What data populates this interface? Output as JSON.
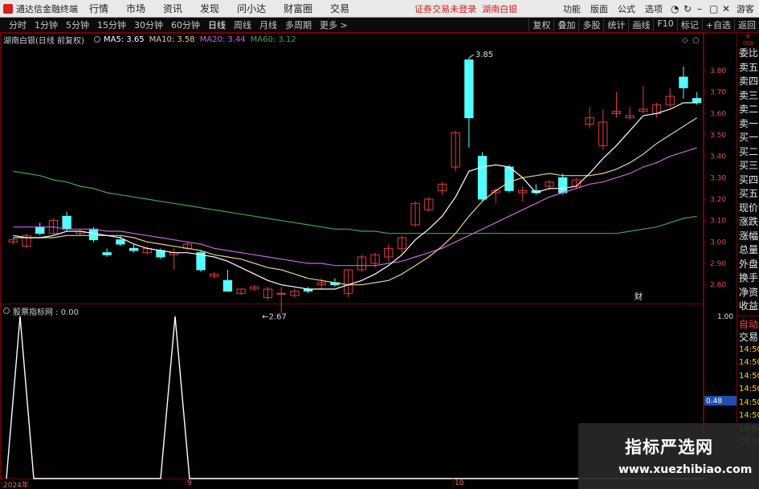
{
  "topbar": {
    "app_title": "通达信金融终端",
    "menu": [
      "行情",
      "市场",
      "资讯",
      "发现",
      "问小达",
      "财富圈",
      "交易"
    ],
    "status": "证券交易未登录",
    "stock": "湖南白银",
    "right": [
      "功能",
      "版面",
      "公式",
      "选项"
    ],
    "guest": "游客"
  },
  "periodbar": {
    "periods": [
      "分时",
      "1分钟",
      "5分钟",
      "15分钟",
      "30分钟",
      "60分钟",
      "日线",
      "周线",
      "月线",
      "多周期",
      "更多 >"
    ],
    "active": "日线",
    "tools": [
      "复权",
      "叠加",
      "多股",
      "统计",
      "画线",
      "F10",
      "标记",
      "+自选",
      "返回"
    ]
  },
  "info": {
    "title": "湖南白银(日线 前复权)",
    "ma5": "MA5: 3.65",
    "ma10": "MA10: 3.58",
    "ma20": "MA20: 3.44",
    "ma60": "MA60: 3.12"
  },
  "sub": {
    "label": "股票指标网 : 0.00"
  },
  "colors": {
    "up": "#e23b3b",
    "down": "#54ffff",
    "ma5": "#ffffff",
    "ma10": "#e6d08a",
    "ma20": "#d060e0",
    "ma60": "#3fa83f",
    "indicator": "#ffffff",
    "frame": "#7a0000"
  },
  "chart_data": [
    {
      "type": "candlestick",
      "series_name": "湖南白银",
      "price_axis": [
        "3.80",
        "3.70",
        "3.60",
        "3.50",
        "3.40",
        "3.30",
        "3.20",
        "3.10",
        "3.00",
        "2.90",
        "2.80"
      ],
      "ylim": [
        2.72,
        3.92
      ],
      "annotations": {
        "high": "3.85",
        "low": "2.67",
        "marker": "财"
      },
      "x_labels": [
        "2024年",
        "9",
        "10"
      ],
      "candles": [
        [
          3.0,
          3.02,
          2.99,
          3.01
        ],
        [
          2.98,
          3.04,
          2.97,
          3.03
        ],
        [
          3.07,
          3.09,
          3.03,
          3.04
        ],
        [
          3.04,
          3.11,
          3.03,
          3.1
        ],
        [
          3.12,
          3.14,
          3.05,
          3.06
        ],
        [
          3.04,
          3.06,
          3.03,
          3.05
        ],
        [
          3.06,
          3.07,
          3.0,
          3.01
        ],
        [
          2.95,
          2.97,
          2.93,
          2.94
        ],
        [
          3.01,
          3.03,
          2.98,
          2.99
        ],
        [
          2.97,
          2.99,
          2.95,
          2.96
        ],
        [
          2.95,
          2.98,
          2.94,
          2.97
        ],
        [
          2.96,
          2.97,
          2.92,
          2.93
        ],
        [
          2.94,
          2.97,
          2.87,
          2.95
        ],
        [
          2.97,
          3.0,
          2.96,
          2.99
        ],
        [
          2.95,
          2.96,
          2.86,
          2.87
        ],
        [
          2.84,
          2.86,
          2.83,
          2.85
        ],
        [
          2.82,
          2.87,
          2.81,
          2.77
        ],
        [
          2.76,
          2.78,
          2.75,
          2.78
        ],
        [
          2.78,
          2.8,
          2.77,
          2.79
        ],
        [
          2.74,
          2.79,
          2.73,
          2.78
        ],
        [
          2.76,
          2.79,
          2.67,
          2.76
        ],
        [
          2.75,
          2.78,
          2.74,
          2.77
        ],
        [
          2.78,
          2.79,
          2.76,
          2.77
        ],
        [
          2.8,
          2.83,
          2.78,
          2.81
        ],
        [
          2.81,
          2.83,
          2.79,
          2.8
        ],
        [
          2.76,
          2.87,
          2.74,
          2.87
        ],
        [
          2.87,
          2.94,
          2.86,
          2.93
        ],
        [
          2.9,
          2.95,
          2.88,
          2.94
        ],
        [
          2.93,
          2.99,
          2.91,
          2.97
        ],
        [
          2.97,
          3.03,
          2.95,
          3.02
        ],
        [
          3.08,
          3.19,
          3.07,
          3.18
        ],
        [
          3.15,
          3.21,
          3.14,
          3.2
        ],
        [
          3.24,
          3.28,
          3.22,
          3.27
        ],
        [
          3.35,
          3.52,
          3.33,
          3.51
        ],
        [
          3.85,
          3.86,
          3.44,
          3.58
        ],
        [
          3.4,
          3.42,
          3.19,
          3.2
        ],
        [
          3.23,
          3.25,
          3.18,
          3.24
        ],
        [
          3.35,
          3.36,
          3.23,
          3.24
        ],
        [
          3.23,
          3.26,
          3.19,
          3.24
        ],
        [
          3.24,
          3.27,
          3.22,
          3.23
        ],
        [
          3.26,
          3.29,
          3.24,
          3.28
        ],
        [
          3.3,
          3.32,
          3.22,
          3.23
        ],
        [
          3.26,
          3.3,
          3.25,
          3.29
        ],
        [
          3.55,
          3.63,
          3.53,
          3.58
        ],
        [
          3.45,
          3.62,
          3.43,
          3.56
        ],
        [
          3.6,
          3.7,
          3.58,
          3.61
        ],
        [
          3.58,
          3.63,
          3.57,
          3.59
        ],
        [
          3.61,
          3.73,
          3.6,
          3.62
        ],
        [
          3.6,
          3.65,
          3.58,
          3.64
        ],
        [
          3.64,
          3.72,
          3.63,
          3.68
        ],
        [
          3.77,
          3.82,
          3.67,
          3.72
        ],
        [
          3.67,
          3.7,
          3.64,
          3.65
        ]
      ],
      "ma5": [
        3.03,
        3.02,
        3.02,
        3.03,
        3.05,
        3.05,
        3.04,
        3.03,
        3.02,
        2.99,
        2.97,
        2.96,
        2.95,
        2.95,
        2.94,
        2.93,
        2.91,
        2.88,
        2.85,
        2.82,
        2.8,
        2.79,
        2.78,
        2.78,
        2.78,
        2.8,
        2.82,
        2.85,
        2.89,
        2.94,
        3.01,
        3.06,
        3.12,
        3.21,
        3.33,
        3.35,
        3.36,
        3.35,
        3.3,
        3.23,
        3.25,
        3.25,
        3.26,
        3.32,
        3.39,
        3.45,
        3.52,
        3.59,
        3.6,
        3.62,
        3.65,
        3.65
      ],
      "ma10": [
        3.02,
        3.02,
        3.02,
        3.02,
        3.03,
        3.03,
        3.03,
        3.03,
        3.03,
        3.02,
        3.0,
        2.99,
        2.98,
        2.97,
        2.96,
        2.94,
        2.93,
        2.92,
        2.9,
        2.88,
        2.87,
        2.85,
        2.83,
        2.82,
        2.81,
        2.8,
        2.8,
        2.81,
        2.82,
        2.85,
        2.89,
        2.93,
        2.98,
        3.04,
        3.12,
        3.19,
        3.24,
        3.28,
        3.3,
        3.31,
        3.32,
        3.31,
        3.31,
        3.31,
        3.32,
        3.34,
        3.37,
        3.41,
        3.46,
        3.5,
        3.54,
        3.58
      ],
      "ma20": [
        3.07,
        3.07,
        3.07,
        3.07,
        3.06,
        3.06,
        3.06,
        3.05,
        3.05,
        3.04,
        3.03,
        3.02,
        3.01,
        3.0,
        2.99,
        2.97,
        2.96,
        2.95,
        2.94,
        2.93,
        2.92,
        2.91,
        2.9,
        2.9,
        2.89,
        2.89,
        2.89,
        2.89,
        2.9,
        2.91,
        2.93,
        2.95,
        2.97,
        3.0,
        3.03,
        3.06,
        3.09,
        3.12,
        3.15,
        3.18,
        3.21,
        3.23,
        3.25,
        3.27,
        3.28,
        3.3,
        3.32,
        3.35,
        3.37,
        3.4,
        3.42,
        3.44
      ],
      "ma60": [
        3.33,
        3.32,
        3.31,
        3.29,
        3.28,
        3.26,
        3.25,
        3.23,
        3.22,
        3.21,
        3.2,
        3.19,
        3.18,
        3.17,
        3.16,
        3.15,
        3.14,
        3.13,
        3.12,
        3.11,
        3.1,
        3.09,
        3.08,
        3.07,
        3.06,
        3.06,
        3.05,
        3.05,
        3.04,
        3.04,
        3.04,
        3.04,
        3.04,
        3.04,
        3.04,
        3.04,
        3.04,
        3.04,
        3.04,
        3.04,
        3.04,
        3.04,
        3.04,
        3.04,
        3.04,
        3.04,
        3.05,
        3.06,
        3.07,
        3.09,
        3.11,
        3.12
      ]
    },
    {
      "type": "line",
      "series_name": "股票指标网",
      "axis": [
        "1.00",
        "0.48"
      ],
      "ylim": [
        0,
        1
      ],
      "values": [
        0,
        1,
        0,
        0,
        0,
        0,
        0,
        0,
        0,
        0,
        0,
        1,
        0,
        0,
        0,
        0,
        0,
        0,
        0,
        0,
        0,
        0,
        0,
        0,
        0,
        0,
        0,
        0,
        0,
        0,
        0,
        0,
        0,
        0,
        0,
        0,
        0,
        0,
        0,
        0,
        0,
        0,
        0,
        0,
        0,
        0,
        0,
        0,
        0,
        0,
        0,
        0
      ]
    }
  ],
  "right_panel": {
    "top": "R\n008",
    "orders": [
      "委比",
      "卖五",
      "卖四",
      "卖三",
      "卖二",
      "卖一",
      "买一",
      "买二",
      "买三",
      "买四",
      "买五",
      "现价",
      "涨跌",
      "涨幅",
      "总量",
      "外盘",
      "换手",
      "净资",
      "收益"
    ],
    "auto_label": "自动",
    "trade_label": "交易",
    "times": [
      "14:50",
      "14:50",
      "14:50",
      "14:50",
      "14:50",
      "14:50",
      "14:50",
      "14:50"
    ]
  },
  "watermark": {
    "line1": "指标严选网",
    "line2": "www.xuezhibiao.com"
  }
}
